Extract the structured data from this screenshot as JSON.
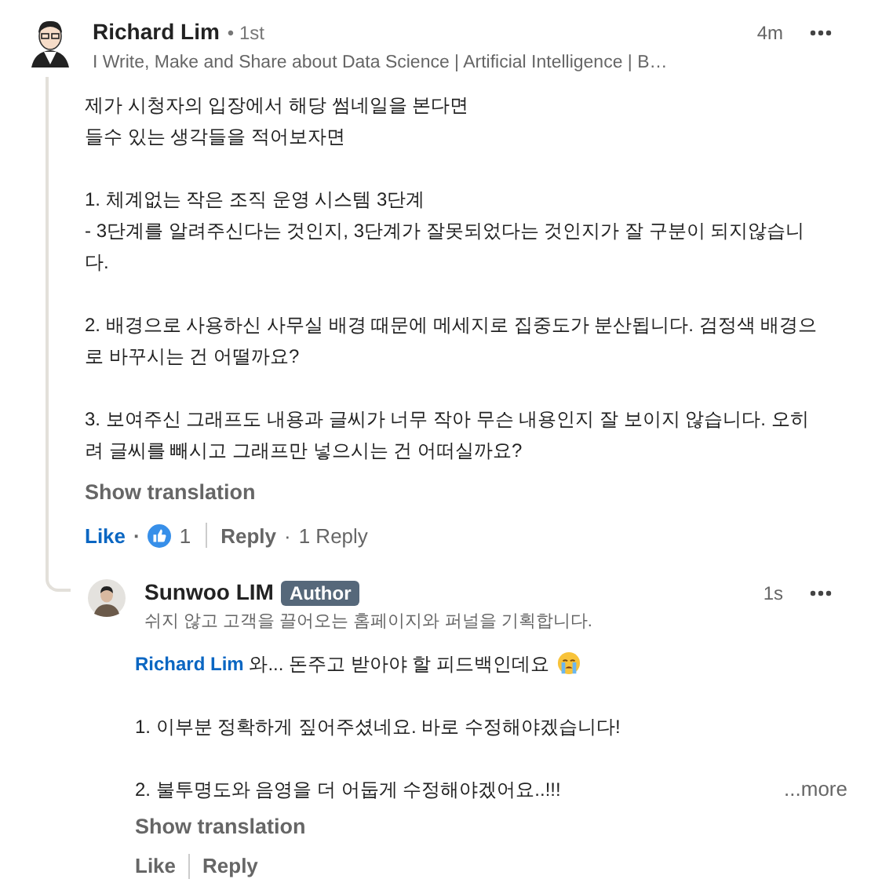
{
  "comment": {
    "author": "Richard Lim",
    "degree": "• 1st",
    "headline": "I Write, Make and Share about Data Science | Artificial Intelligence | B…",
    "time": "4m",
    "paragraphs": [
      "제가 시청자의 입장에서 해당 썸네일을 본다면\n들수 있는 생각들을 적어보자면",
      "1. 체계없는 작은 조직 운영 시스템 3단계\n- 3단계를 알려주신다는 것인지, 3단계가 잘못되었다는 것인지가 잘 구분이 되지않습니다.",
      "2. 배경으로 사용하신 사무실 배경 때문에 메세지로 집중도가 분산됩니다. 검정색 배경으로 바꾸시는 건 어떨까요?",
      "3. 보여주신 그래프도 내용과 글씨가 너무 작아 무슨 내용인지 잘 보이지 않습니다. 오히려 글씨를 빼시고 그래프만 넣으시는 건 어떠실까요?"
    ],
    "show_translation": "Show translation",
    "like": "Like",
    "separator": "·",
    "liked": true,
    "reaction_count": "1",
    "reply": "Reply",
    "reply_count": "1 Reply"
  },
  "reply": {
    "author": "Sunwoo LIM",
    "badge": "Author",
    "headline": "쉬지 않고 고객을 끌어오는 홈페이지와 퍼널을 기획합니다.",
    "time": "1s",
    "mention": "Richard Lim",
    "first_line": "와... 돈주고 받아야 할 피드백인데요",
    "paragraphs": [
      "1. 이부분 정확하게 짚어주셨네요. 바로 수정해야겠습니다!",
      "2. 불투명도와 음영을 더 어둡게 수정해야겠어요..!!!"
    ],
    "more": "...more",
    "show_translation": "Show translation",
    "like": "Like",
    "liked": false,
    "reply": "Reply"
  }
}
